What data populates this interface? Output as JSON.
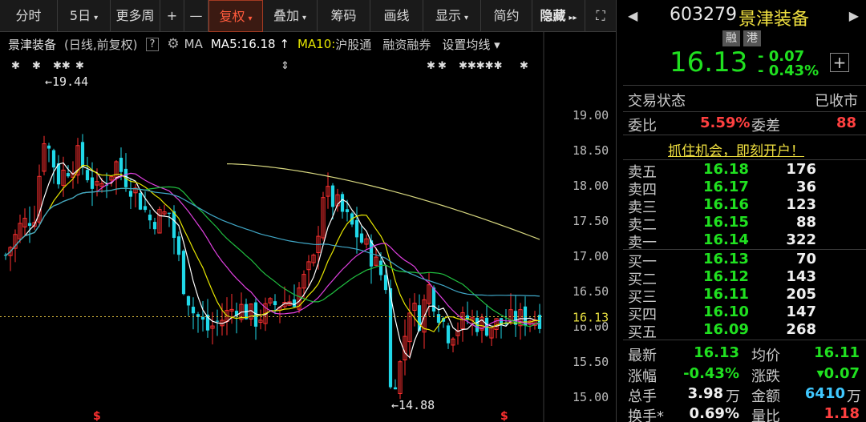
{
  "toolbar": {
    "items": [
      {
        "label": "分时",
        "w": 0
      },
      {
        "label": "5日",
        "caret": "▾"
      },
      {
        "label": "更多周",
        "caret": ""
      },
      {
        "label": "+",
        "caret": ""
      },
      {
        "label": "—",
        "caret": ""
      },
      {
        "label": "复权",
        "caret": "▾",
        "active": true
      },
      {
        "label": "叠加",
        "caret": "▾"
      },
      {
        "label": "筹码",
        "caret": ""
      },
      {
        "label": "画线",
        "caret": ""
      },
      {
        "label": "显示",
        "caret": "▾"
      },
      {
        "label": "简约",
        "caret": ""
      },
      {
        "label": "隐藏",
        "caret": "▸▸"
      },
      {
        "label": "⛶",
        "caret": ""
      }
    ]
  },
  "info": {
    "name": "景津装备",
    "mode": "(日线,前复权)",
    "help": "?",
    "ma_label": "MA",
    "ma5": "MA5:16.18 ↑",
    "ma10": "MA10:",
    "hgt": "沪股通",
    "rzrq": "融资融券",
    "setting": "设置均线 ▾"
  },
  "chart_data": {
    "type": "candlestick",
    "ylim": [
      14.8,
      19.6
    ],
    "y_ticks": [
      "19.00",
      "18.50",
      "18.00",
      "17.50",
      "17.00",
      "16.50",
      "16.00",
      "15.50",
      "15.00"
    ],
    "last_price_label": "16.13",
    "max_label": "19.44",
    "min_label": "14.88",
    "series_colors": {
      "ma5": "#ffffff",
      "ma10": "#e6e600",
      "ma20": "#e040e0",
      "ma30": "#20c040",
      "ma60": "#40a8c8",
      "ma120": "#909090",
      "ma250": "#d8d880"
    }
  },
  "stock": {
    "code": "603279",
    "name": "景津装备",
    "tag1": "融",
    "tag2": "港",
    "price": "16.13",
    "change": "- 0.07",
    "pct": "- 0.43%",
    "add": "+"
  },
  "status": {
    "label": "交易状态",
    "value": "已收市"
  },
  "ratio": {
    "wb_label": "委比",
    "wb_value": "5.59%",
    "wc_label": "委差",
    "wc_value": "88"
  },
  "promo": "抓住机会，即刻开户！",
  "orderbook": {
    "sells": [
      {
        "label": "卖五",
        "price": "16.18",
        "vol": "176"
      },
      {
        "label": "卖四",
        "price": "16.17",
        "vol": "36"
      },
      {
        "label": "卖三",
        "price": "16.16",
        "vol": "123"
      },
      {
        "label": "卖二",
        "price": "16.15",
        "vol": "88"
      },
      {
        "label": "卖一",
        "price": "16.14",
        "vol": "322"
      }
    ],
    "buys": [
      {
        "label": "买一",
        "price": "16.13",
        "vol": "70"
      },
      {
        "label": "买二",
        "price": "16.12",
        "vol": "143"
      },
      {
        "label": "买三",
        "price": "16.11",
        "vol": "205"
      },
      {
        "label": "买四",
        "price": "16.10",
        "vol": "147"
      },
      {
        "label": "买五",
        "price": "16.09",
        "vol": "268"
      }
    ]
  },
  "stats": {
    "latest_l": "最新",
    "latest_v": "16.13",
    "avg_l": "均价",
    "avg_v": "16.11",
    "pct_l": "涨幅",
    "pct_v": "-0.43%",
    "chg_l": "涨跌",
    "chg_v": "▾0.07",
    "hand_l": "总手",
    "hand_v": "3.98",
    "hand_u": "万",
    "amt_l": "金额",
    "amt_v": "6410",
    "amt_u": "万",
    "turn_l": "换手*",
    "turn_v": "0.69%",
    "vr_l": "量比",
    "vr_v": "1.18"
  }
}
